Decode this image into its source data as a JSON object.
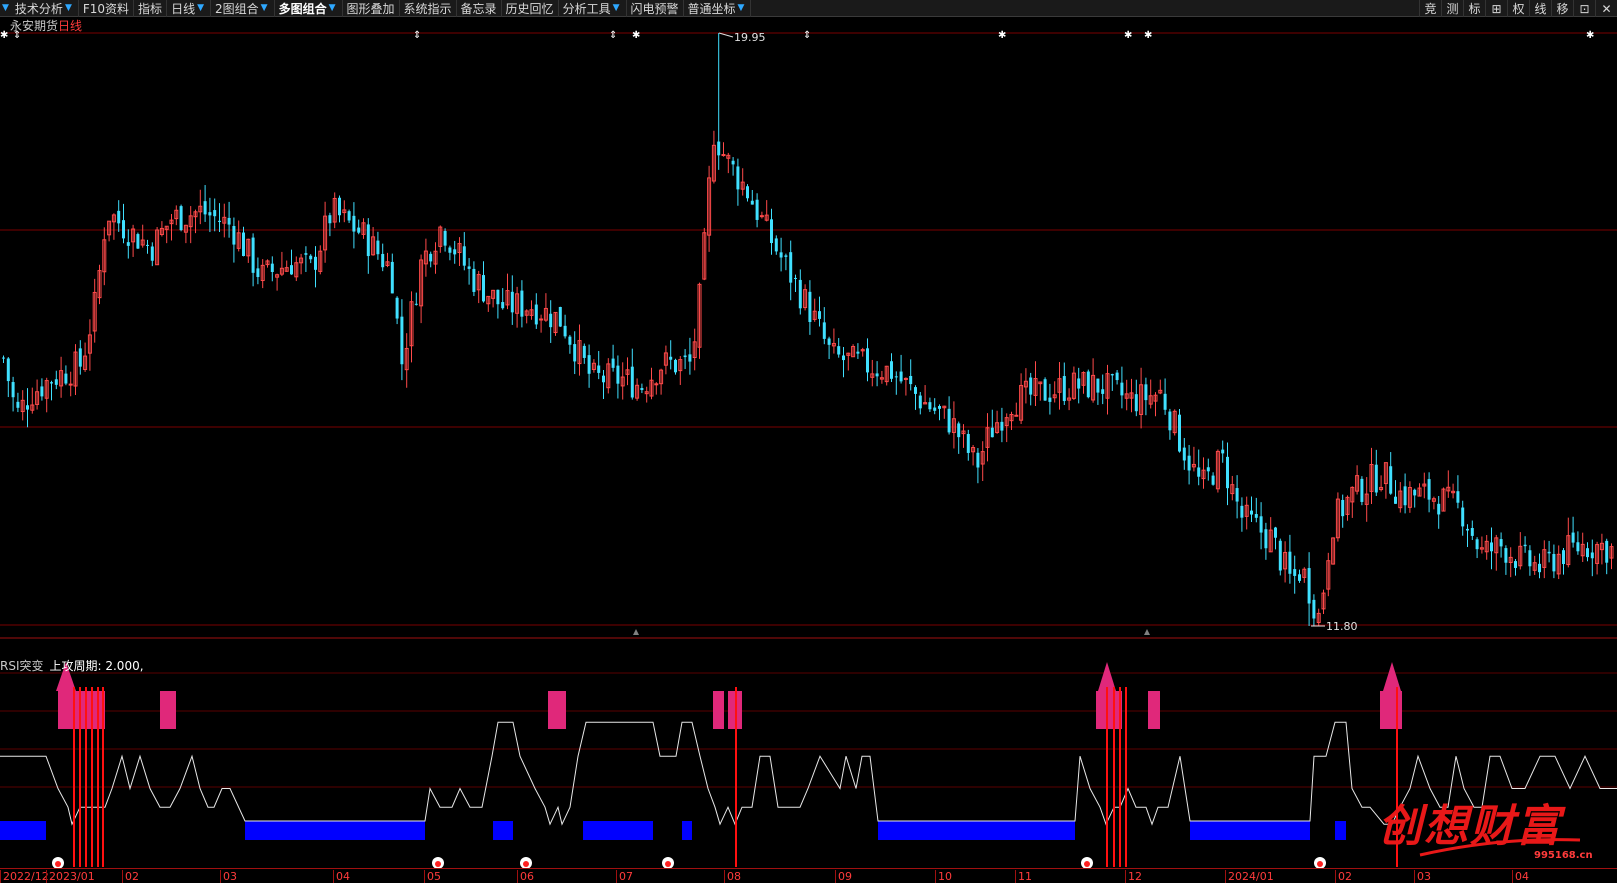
{
  "toolbar": {
    "items": [
      {
        "label": "技术分析",
        "drop": true
      },
      {
        "label": "F10资料",
        "drop": false
      },
      {
        "label": "指标",
        "drop": false
      },
      {
        "label": "日线",
        "drop": true
      },
      {
        "label": "2图组合",
        "drop": true
      },
      {
        "label": "多图组合",
        "drop": true,
        "active": true
      },
      {
        "label": "图形叠加",
        "drop": false
      },
      {
        "label": "系统指示",
        "drop": false
      },
      {
        "label": "备忘录",
        "drop": false
      },
      {
        "label": "历史回忆",
        "drop": false
      },
      {
        "label": "分析工具",
        "drop": true
      },
      {
        "label": "闪电预警",
        "drop": false
      },
      {
        "label": "普通坐标",
        "drop": true
      }
    ],
    "right_buttons": [
      "竞",
      "测",
      "标",
      "⊞",
      "权",
      "线",
      "移",
      "⊡",
      "✕"
    ]
  },
  "main": {
    "stock_name": "永安期货",
    "period": "日线",
    "high_label": "19.95",
    "low_label": "11.80",
    "colors": {
      "up": "#ff4a4a",
      "down": "#40e0ff",
      "grid": "#7a0000"
    }
  },
  "indicator": {
    "name": "RSI突变",
    "param_text": "上攻周期: 2.000,",
    "colors": {
      "line": "#e8e8e8",
      "band": "#0000ff",
      "hot": "#e0287a",
      "signal": "#ff1010"
    }
  },
  "date_axis": [
    "2022/12",
    "2023/01",
    "02",
    "03",
    "04",
    "05",
    "06",
    "07",
    "08",
    "09",
    "10",
    "11",
    "12",
    "2024/01",
    "02",
    "03",
    "04"
  ],
  "watermark": {
    "text": "创想财富",
    "url": "995168.cn"
  },
  "chart_data": {
    "type": "candlestick",
    "high": 19.95,
    "low": 11.8,
    "indicator_series": "RSI突变"
  }
}
